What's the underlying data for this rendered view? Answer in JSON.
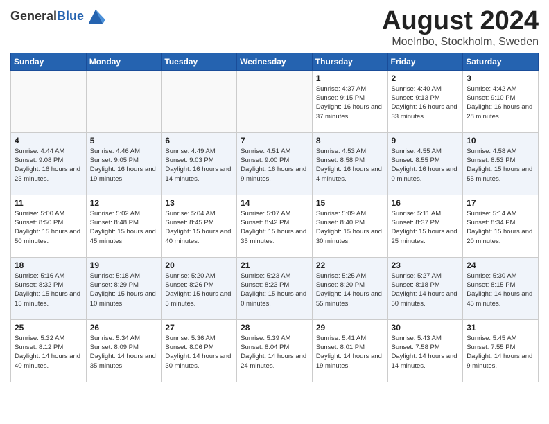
{
  "header": {
    "logo_general": "General",
    "logo_blue": "Blue",
    "month_year": "August 2024",
    "location": "Moelnbo, Stockholm, Sweden"
  },
  "weekdays": [
    "Sunday",
    "Monday",
    "Tuesday",
    "Wednesday",
    "Thursday",
    "Friday",
    "Saturday"
  ],
  "weeks": [
    [
      {
        "day": "",
        "info": ""
      },
      {
        "day": "",
        "info": ""
      },
      {
        "day": "",
        "info": ""
      },
      {
        "day": "",
        "info": ""
      },
      {
        "day": "1",
        "info": "Sunrise: 4:37 AM\nSunset: 9:15 PM\nDaylight: 16 hours\nand 37 minutes."
      },
      {
        "day": "2",
        "info": "Sunrise: 4:40 AM\nSunset: 9:13 PM\nDaylight: 16 hours\nand 33 minutes."
      },
      {
        "day": "3",
        "info": "Sunrise: 4:42 AM\nSunset: 9:10 PM\nDaylight: 16 hours\nand 28 minutes."
      }
    ],
    [
      {
        "day": "4",
        "info": "Sunrise: 4:44 AM\nSunset: 9:08 PM\nDaylight: 16 hours\nand 23 minutes."
      },
      {
        "day": "5",
        "info": "Sunrise: 4:46 AM\nSunset: 9:05 PM\nDaylight: 16 hours\nand 19 minutes."
      },
      {
        "day": "6",
        "info": "Sunrise: 4:49 AM\nSunset: 9:03 PM\nDaylight: 16 hours\nand 14 minutes."
      },
      {
        "day": "7",
        "info": "Sunrise: 4:51 AM\nSunset: 9:00 PM\nDaylight: 16 hours\nand 9 minutes."
      },
      {
        "day": "8",
        "info": "Sunrise: 4:53 AM\nSunset: 8:58 PM\nDaylight: 16 hours\nand 4 minutes."
      },
      {
        "day": "9",
        "info": "Sunrise: 4:55 AM\nSunset: 8:55 PM\nDaylight: 16 hours\nand 0 minutes."
      },
      {
        "day": "10",
        "info": "Sunrise: 4:58 AM\nSunset: 8:53 PM\nDaylight: 15 hours\nand 55 minutes."
      }
    ],
    [
      {
        "day": "11",
        "info": "Sunrise: 5:00 AM\nSunset: 8:50 PM\nDaylight: 15 hours\nand 50 minutes."
      },
      {
        "day": "12",
        "info": "Sunrise: 5:02 AM\nSunset: 8:48 PM\nDaylight: 15 hours\nand 45 minutes."
      },
      {
        "day": "13",
        "info": "Sunrise: 5:04 AM\nSunset: 8:45 PM\nDaylight: 15 hours\nand 40 minutes."
      },
      {
        "day": "14",
        "info": "Sunrise: 5:07 AM\nSunset: 8:42 PM\nDaylight: 15 hours\nand 35 minutes."
      },
      {
        "day": "15",
        "info": "Sunrise: 5:09 AM\nSunset: 8:40 PM\nDaylight: 15 hours\nand 30 minutes."
      },
      {
        "day": "16",
        "info": "Sunrise: 5:11 AM\nSunset: 8:37 PM\nDaylight: 15 hours\nand 25 minutes."
      },
      {
        "day": "17",
        "info": "Sunrise: 5:14 AM\nSunset: 8:34 PM\nDaylight: 15 hours\nand 20 minutes."
      }
    ],
    [
      {
        "day": "18",
        "info": "Sunrise: 5:16 AM\nSunset: 8:32 PM\nDaylight: 15 hours\nand 15 minutes."
      },
      {
        "day": "19",
        "info": "Sunrise: 5:18 AM\nSunset: 8:29 PM\nDaylight: 15 hours\nand 10 minutes."
      },
      {
        "day": "20",
        "info": "Sunrise: 5:20 AM\nSunset: 8:26 PM\nDaylight: 15 hours\nand 5 minutes."
      },
      {
        "day": "21",
        "info": "Sunrise: 5:23 AM\nSunset: 8:23 PM\nDaylight: 15 hours\nand 0 minutes."
      },
      {
        "day": "22",
        "info": "Sunrise: 5:25 AM\nSunset: 8:20 PM\nDaylight: 14 hours\nand 55 minutes."
      },
      {
        "day": "23",
        "info": "Sunrise: 5:27 AM\nSunset: 8:18 PM\nDaylight: 14 hours\nand 50 minutes."
      },
      {
        "day": "24",
        "info": "Sunrise: 5:30 AM\nSunset: 8:15 PM\nDaylight: 14 hours\nand 45 minutes."
      }
    ],
    [
      {
        "day": "25",
        "info": "Sunrise: 5:32 AM\nSunset: 8:12 PM\nDaylight: 14 hours\nand 40 minutes."
      },
      {
        "day": "26",
        "info": "Sunrise: 5:34 AM\nSunset: 8:09 PM\nDaylight: 14 hours\nand 35 minutes."
      },
      {
        "day": "27",
        "info": "Sunrise: 5:36 AM\nSunset: 8:06 PM\nDaylight: 14 hours\nand 30 minutes."
      },
      {
        "day": "28",
        "info": "Sunrise: 5:39 AM\nSunset: 8:04 PM\nDaylight: 14 hours\nand 24 minutes."
      },
      {
        "day": "29",
        "info": "Sunrise: 5:41 AM\nSunset: 8:01 PM\nDaylight: 14 hours\nand 19 minutes."
      },
      {
        "day": "30",
        "info": "Sunrise: 5:43 AM\nSunset: 7:58 PM\nDaylight: 14 hours\nand 14 minutes."
      },
      {
        "day": "31",
        "info": "Sunrise: 5:45 AM\nSunset: 7:55 PM\nDaylight: 14 hours\nand 9 minutes."
      }
    ]
  ]
}
